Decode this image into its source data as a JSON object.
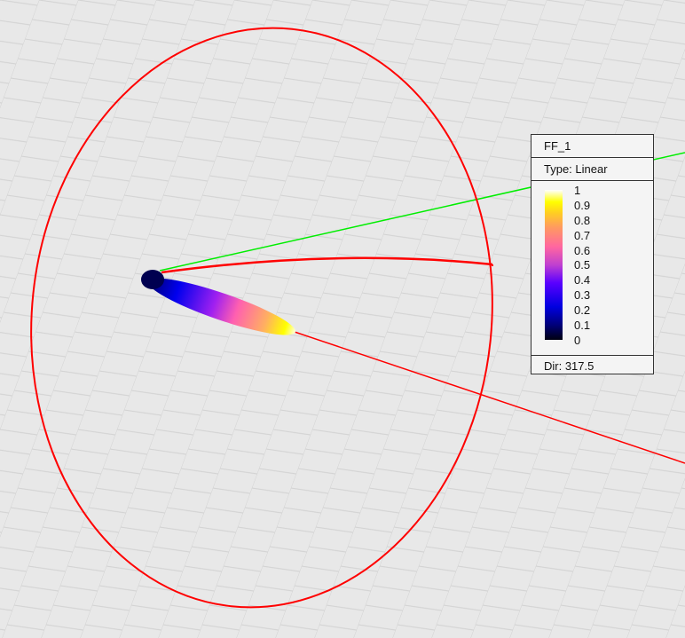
{
  "legend": {
    "title": "FF_1",
    "type": "Type: Linear",
    "ticks": [
      "1",
      "0.9",
      "0.8",
      "0.7",
      "0.6",
      "0.5",
      "0.4",
      "0.3",
      "0.2",
      "0.1",
      "0"
    ],
    "dir": "Dir: 317.5"
  },
  "colors": {
    "axis_x": "#ff0000",
    "axis_y": "#00ee00",
    "background": "#e8e8e8",
    "grid": "#d4d4d4"
  }
}
